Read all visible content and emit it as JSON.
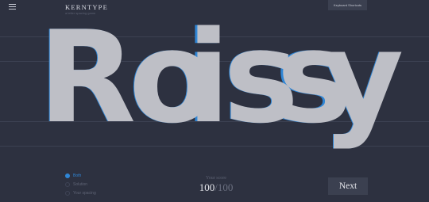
{
  "header": {
    "title": "KERNTYPE",
    "subtitle": "a letter spacing game",
    "shortcuts_label": "Keyboard Shortcuts"
  },
  "puzzle": {
    "word": "Roissy",
    "letters": [
      "R",
      "o",
      "i",
      "s",
      "s",
      "y"
    ],
    "solution_color": "#bebfc6",
    "user_color": "#2f86d6"
  },
  "legend": {
    "items": [
      {
        "label": "Both",
        "selected": true
      },
      {
        "label": "Solution",
        "selected": false
      },
      {
        "label": "Your spacing",
        "selected": false
      }
    ]
  },
  "score": {
    "caption": "Your score",
    "value": "100",
    "separator": "/",
    "max": "100"
  },
  "next_label": "Next",
  "colors": {
    "background": "#2d3140",
    "accent": "#2f86d6",
    "button": "#3b4050"
  }
}
